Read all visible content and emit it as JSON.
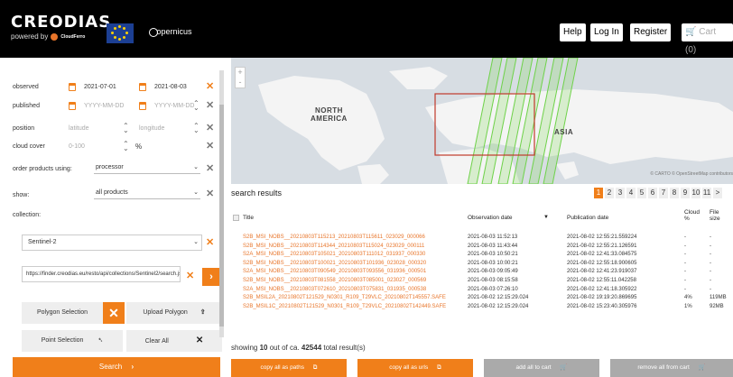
{
  "header": {
    "brand": "CREODIAS",
    "tagline": "powered by",
    "partner": "CloudFerro",
    "copernicus": "opernicus",
    "nav": {
      "help": "Help",
      "login": "Log In",
      "register": "Register",
      "cart": "Cart (0)"
    }
  },
  "filters": {
    "observed": {
      "label": "observed",
      "from": "2021-07-01",
      "to": "2021-08-03"
    },
    "published": {
      "label": "published",
      "from_placeholder": "YYYY-MM-DD",
      "to_placeholder": "YYYY-MM-DD"
    },
    "position": {
      "label": "position",
      "lat_placeholder": "latitude",
      "lon_placeholder": "longitude"
    },
    "cloud_cover": {
      "label": "cloud cover",
      "placeholder": "0-100",
      "unit": "%"
    },
    "order_using": {
      "label": "order products using:",
      "value": "processor"
    },
    "show": {
      "label": "show:",
      "value": "all products"
    },
    "collection": {
      "label": "collection:",
      "value": "Sentinel-2"
    },
    "url": "https://finder.creodias.eu/resto/api/collections/Sentinel2/search.json"
  },
  "tools": {
    "polygon": "Polygon Selection",
    "upload": "Upload Polygon",
    "point": "Point Selection",
    "clear": "Clear All",
    "search": "Search"
  },
  "map": {
    "zoom_in": "+",
    "zoom_out": "-",
    "north_america_1": "NORTH",
    "north_america_2": "AMERICA",
    "asia": "ASIA",
    "attribution": "© CARTO © OpenStreetMap contributors"
  },
  "results": {
    "title": "search results",
    "pages": [
      "1",
      "2",
      "3",
      "4",
      "5",
      "6",
      "7",
      "8",
      "9",
      "10",
      "11"
    ],
    "next": ">",
    "active_page": "1",
    "columns": {
      "title": "Title",
      "observation": "Observation date",
      "sort": "▼",
      "publication": "Publication date",
      "cloud": "Cloud %",
      "size": "File size"
    },
    "rows": [
      {
        "title": "S2B_MSI_NOBS__20210803T115213_20210803T115611_023029_000066",
        "obs": "2021-08-03 11:52:13",
        "pub": "2021-08-02 12:55:21.559224",
        "cloud": "-",
        "size": "-"
      },
      {
        "title": "S2B_MSI_NOBS__20210803T114344_20210803T115024_023029_000111",
        "obs": "2021-08-03 11:43:44",
        "pub": "2021-08-02 12:55:21.126591",
        "cloud": "-",
        "size": "-"
      },
      {
        "title": "S2A_MSI_NOBS__20210803T105021_20210803T111012_031937_000330",
        "obs": "2021-08-03 10:50:21",
        "pub": "2021-08-02 12:41:33.084575",
        "cloud": "-",
        "size": "-"
      },
      {
        "title": "S2B_MSI_NOBS__20210803T100021_20210803T101936_023028_000320",
        "obs": "2021-08-03 10:00:21",
        "pub": "2021-08-02 12:55:18.900605",
        "cloud": "-",
        "size": "-"
      },
      {
        "title": "S2A_MSI_NOBS__20210803T090549_20210803T093556_031936_000501",
        "obs": "2021-08-03 09:05:49",
        "pub": "2021-08-02 12:41:23.919037",
        "cloud": "-",
        "size": "-"
      },
      {
        "title": "S2B_MSI_NOBS__20210803T081558_20210803T085001_023027_000569",
        "obs": "2021-08-03 08:15:58",
        "pub": "2021-08-02 12:55:11.042258",
        "cloud": "-",
        "size": "-"
      },
      {
        "title": "S2A_MSI_NOBS__20210803T072610_20210803T075831_031935_000538",
        "obs": "2021-08-03 07:26:10",
        "pub": "2021-08-02 12:41:18.305922",
        "cloud": "-",
        "size": "-"
      },
      {
        "title": "S2B_MSIL2A_20210802T121529_N0301_R109_T29VLC_20210802T145557.SAFE",
        "obs": "2021-08-02 12:15:29.024",
        "pub": "2021-08-02 19:19:20.869695",
        "cloud": "4%",
        "size": "119MB"
      },
      {
        "title": "S2B_MSIL1C_20210802T121529_N0301_R109_T29VLC_20210802T142449.SAFE",
        "obs": "2021-08-02 12:15:29.024",
        "pub": "2021-08-02 15:23:40.305976",
        "cloud": "1%",
        "size": "92MB"
      }
    ],
    "showing_prefix": "showing",
    "showing_count": "10",
    "showing_mid": "out of ca.",
    "showing_total": "42544",
    "showing_suffix": "total result(s)"
  },
  "actions": {
    "copy_paths": "copy all as paths",
    "copy_urls": "copy all as urls",
    "add_cart": "add all to cart",
    "remove_cart": "remove all from cart"
  },
  "colors": {
    "accent": "#f07f1a",
    "header": "#000000",
    "swath": "#7ed957",
    "selection": "#c0392b"
  }
}
